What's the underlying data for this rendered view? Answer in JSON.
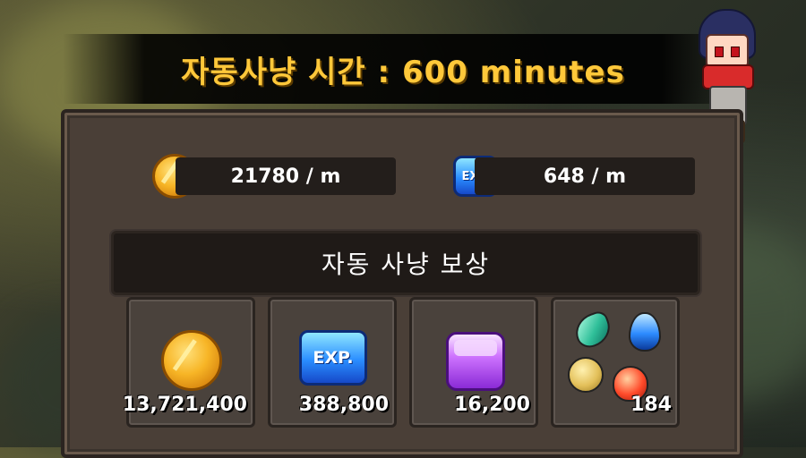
{
  "header": {
    "title": "자동사냥 시간 : 600 minutes"
  },
  "rates": {
    "gold": "21780 / m",
    "exp": "648 / m",
    "exp_icon_label": "EXP."
  },
  "rewards": {
    "section_title": "자동 사냥 보상",
    "items": [
      {
        "icon": "gold-coin-icon",
        "value": "13,721,400"
      },
      {
        "icon": "exp-icon",
        "value": "388,800",
        "icon_label": "EXP."
      },
      {
        "icon": "purple-cube-icon",
        "value": "16,200"
      },
      {
        "icon": "elemental-gems-icon",
        "value": "184"
      }
    ]
  }
}
